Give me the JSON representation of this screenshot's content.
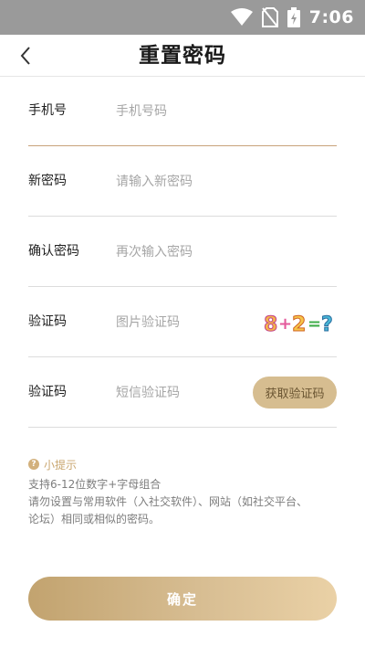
{
  "status_bar": {
    "time": "7:06",
    "icons": [
      "wifi-icon",
      "no-sim-icon",
      "battery-charging-icon"
    ],
    "background": "#9a9a9a"
  },
  "header": {
    "title": "重置密码",
    "back_icon": "chevron-left-icon"
  },
  "form": {
    "phone": {
      "label": "手机号",
      "placeholder": "手机号码",
      "value": ""
    },
    "new_password": {
      "label": "新密码",
      "placeholder": "请输入新密码",
      "value": ""
    },
    "confirm_password": {
      "label": "确认密码",
      "placeholder": "再次输入密码",
      "value": ""
    },
    "image_captcha": {
      "label": "验证码",
      "placeholder": "图片验证码",
      "value": "",
      "captcha_text": "8+2=?"
    },
    "sms_code": {
      "label": "验证码",
      "placeholder": "短信验证码",
      "value": "",
      "button_label": "获取验证码"
    }
  },
  "tips": {
    "title": "小提示",
    "icon": "question-circle-icon",
    "lines": [
      "支持6-12位数字+字母组合",
      "请勿设置与常用软件（入社交软件）、网站（如社交平台、",
      "论坛）相同或相似的密码。"
    ]
  },
  "confirm_button": {
    "label": "确定"
  },
  "colors": {
    "accent": "#d6bd90",
    "accent_dark": "#c2a36f",
    "active_underline": "#c8a27a",
    "tip_text": "#c9a66f"
  }
}
